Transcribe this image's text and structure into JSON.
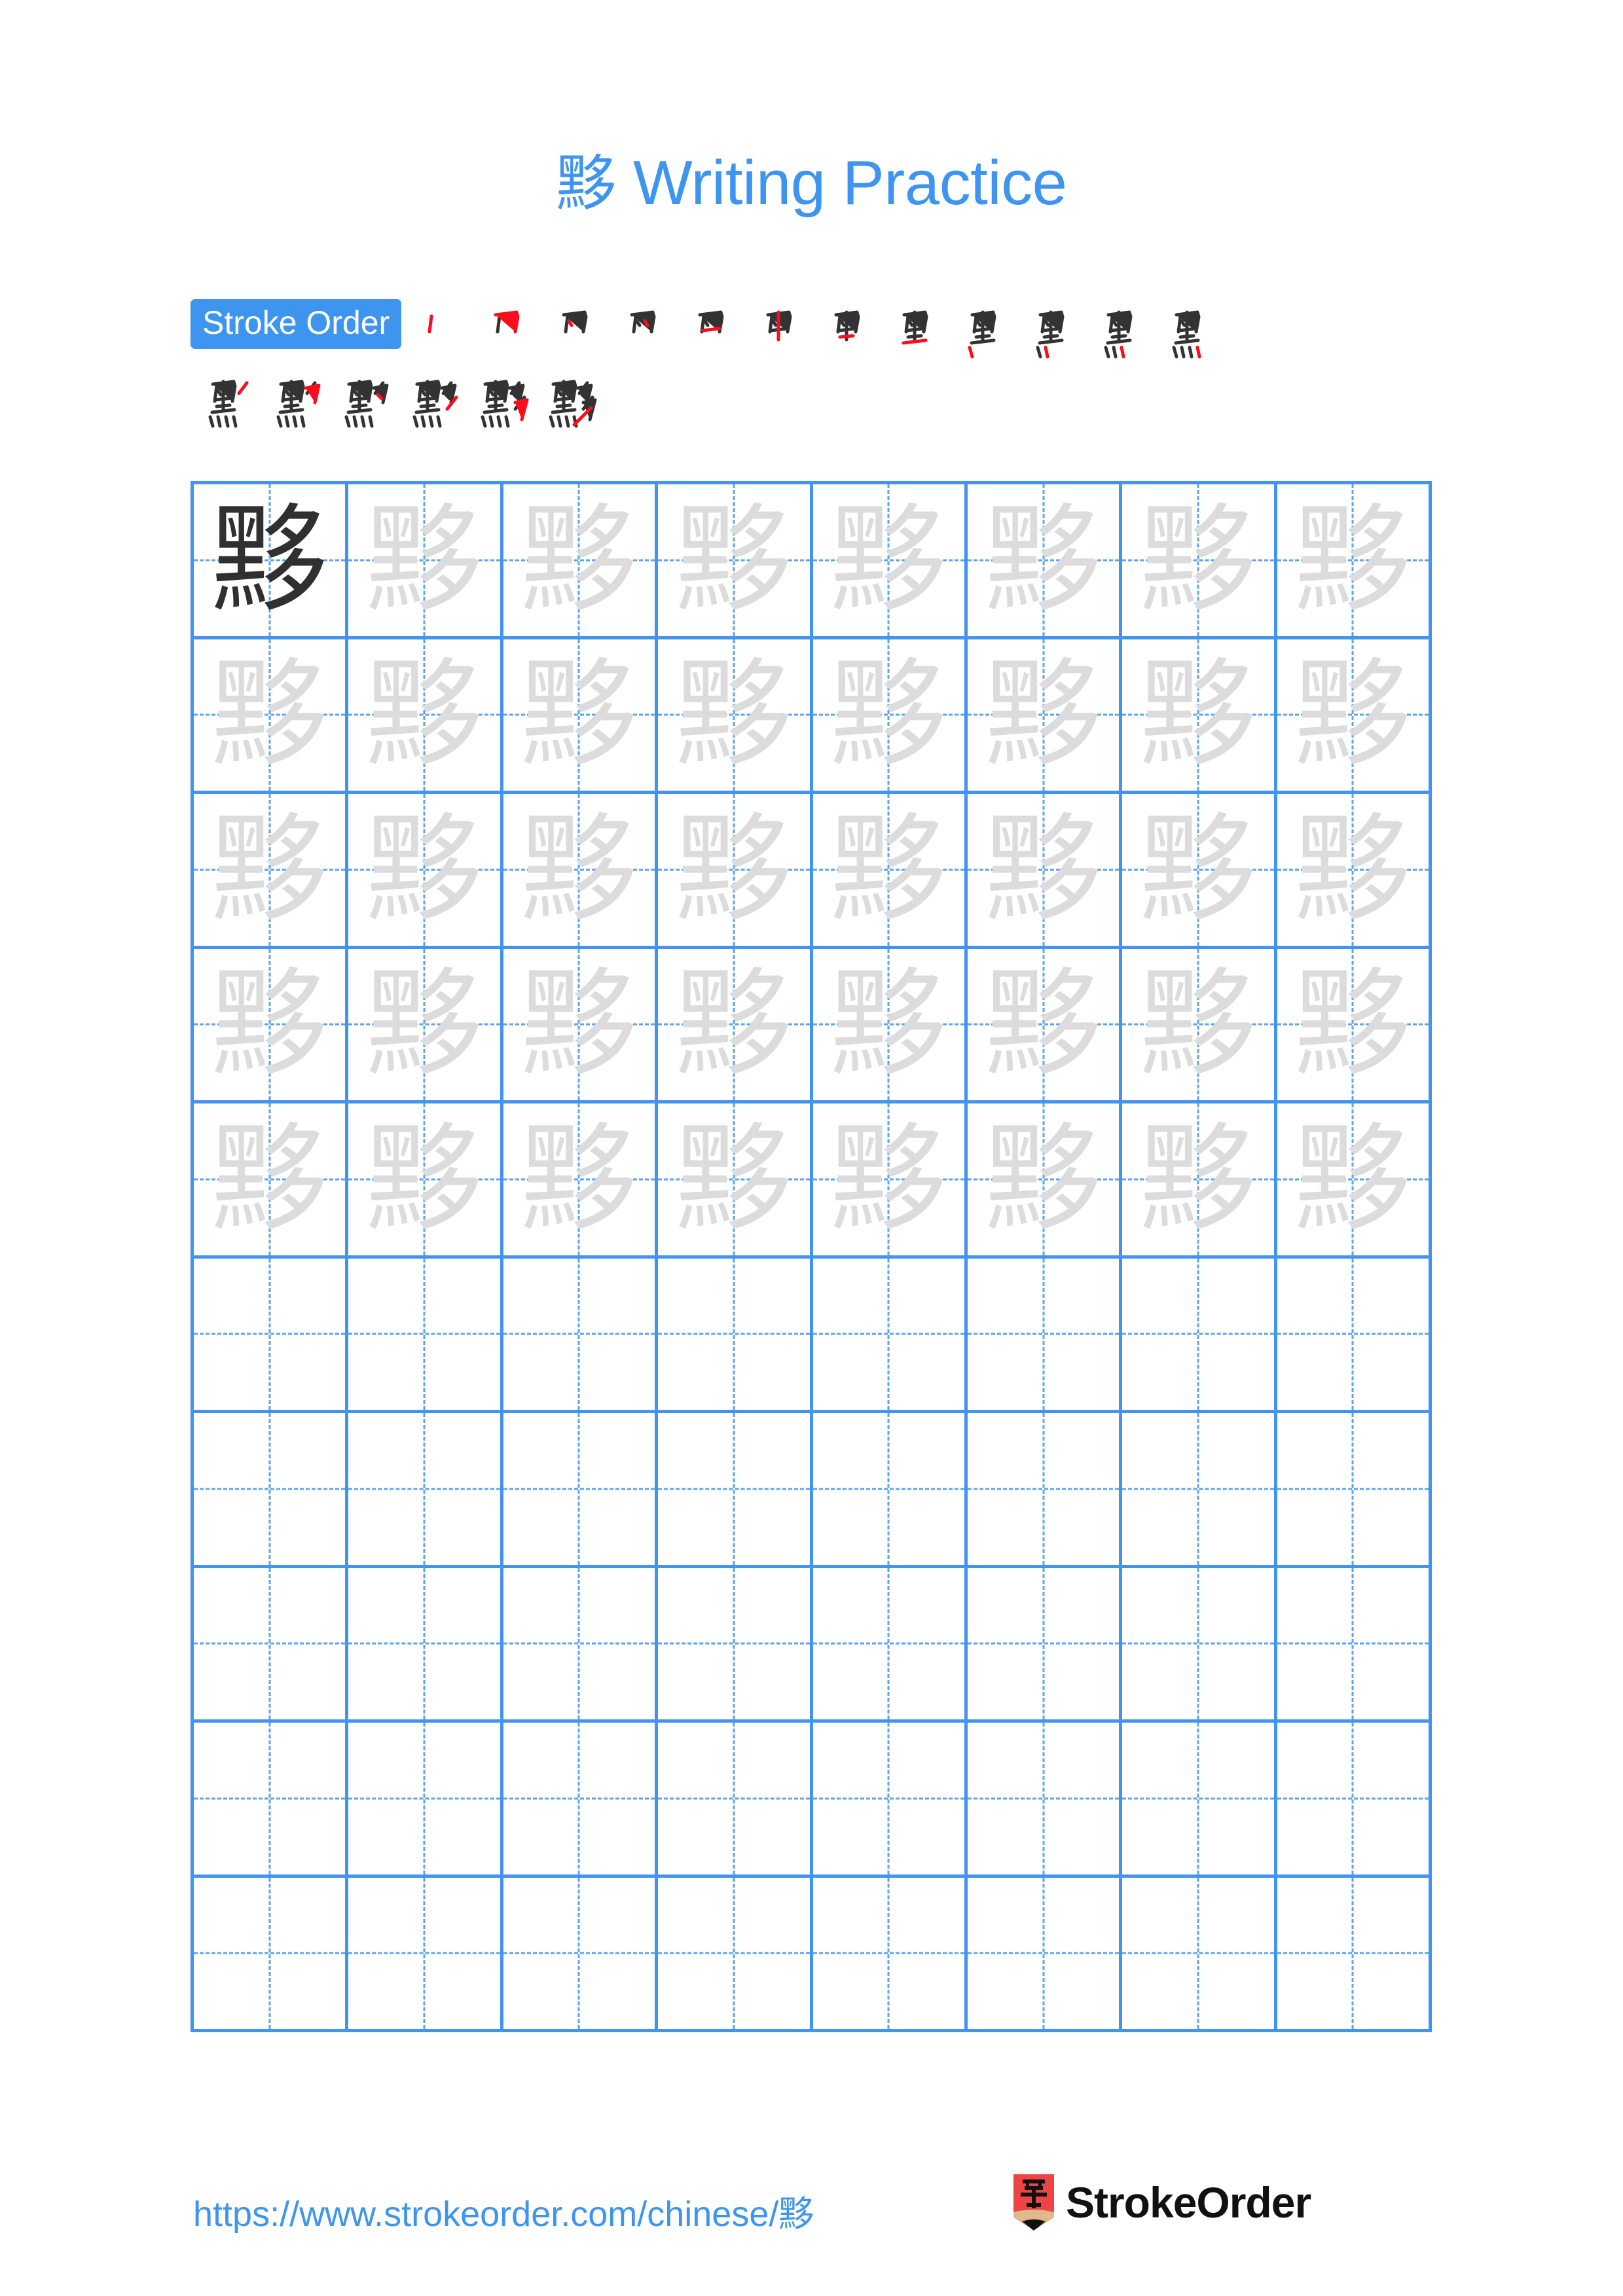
{
  "page": {
    "character": "黟",
    "title_suffix": " Writing Practice",
    "title_full": "黟 Writing Practice",
    "background_color": "#ffffff",
    "accent_color": "#3d95ef",
    "grid_line_color": "#4294f0",
    "guide_line_color": "#5ba4f2",
    "ghost_char_color": "#dcdcdc",
    "dark_char_color": "#303030",
    "stroke_done_color": "#333333",
    "stroke_new_color": "#fc0d1b"
  },
  "stroke_order": {
    "badge_label": "Stroke Order",
    "total_strokes": 18,
    "rows": [
      {
        "steps": [
          {
            "index": 1,
            "partial": "丨"
          },
          {
            "index": 2,
            "partial": "冂"
          },
          {
            "index": 3,
            "partial": "冂"
          },
          {
            "index": 4,
            "partial": "冃"
          },
          {
            "index": 5,
            "partial": "日"
          },
          {
            "index": 6,
            "partial": "甲"
          },
          {
            "index": 7,
            "partial": "甲"
          },
          {
            "index": 8,
            "partial": "里"
          },
          {
            "index": 9,
            "partial": "里"
          },
          {
            "index": 10,
            "partial": "黑"
          },
          {
            "index": 11,
            "partial": "黑"
          },
          {
            "index": 12,
            "partial": "黑"
          }
        ]
      },
      {
        "steps": [
          {
            "index": 13,
            "partial": "黑"
          },
          {
            "index": 14,
            "partial": "黔"
          },
          {
            "index": 15,
            "partial": "黟"
          },
          {
            "index": 16,
            "partial": "黟"
          },
          {
            "index": 17,
            "partial": "黟"
          },
          {
            "index": 18,
            "partial": "黟"
          }
        ]
      }
    ]
  },
  "practice_grid": {
    "columns": 8,
    "rows": 10,
    "filled_rows": 5,
    "empty_rows": 5,
    "first_cell_style": "dark",
    "trace_cell_style": "ghost",
    "character": "黟"
  },
  "footer": {
    "url_prefix": "https://www.strokeorder.com/chinese/",
    "url_character": "黟",
    "url_full": "https://www.strokeorder.com/chinese/黟",
    "brand_name": "StrokeOrder",
    "brand_logo_char": "字",
    "brand_logo_color": "#ef4444",
    "brand_logo_tip_color": "#e0b88c"
  }
}
